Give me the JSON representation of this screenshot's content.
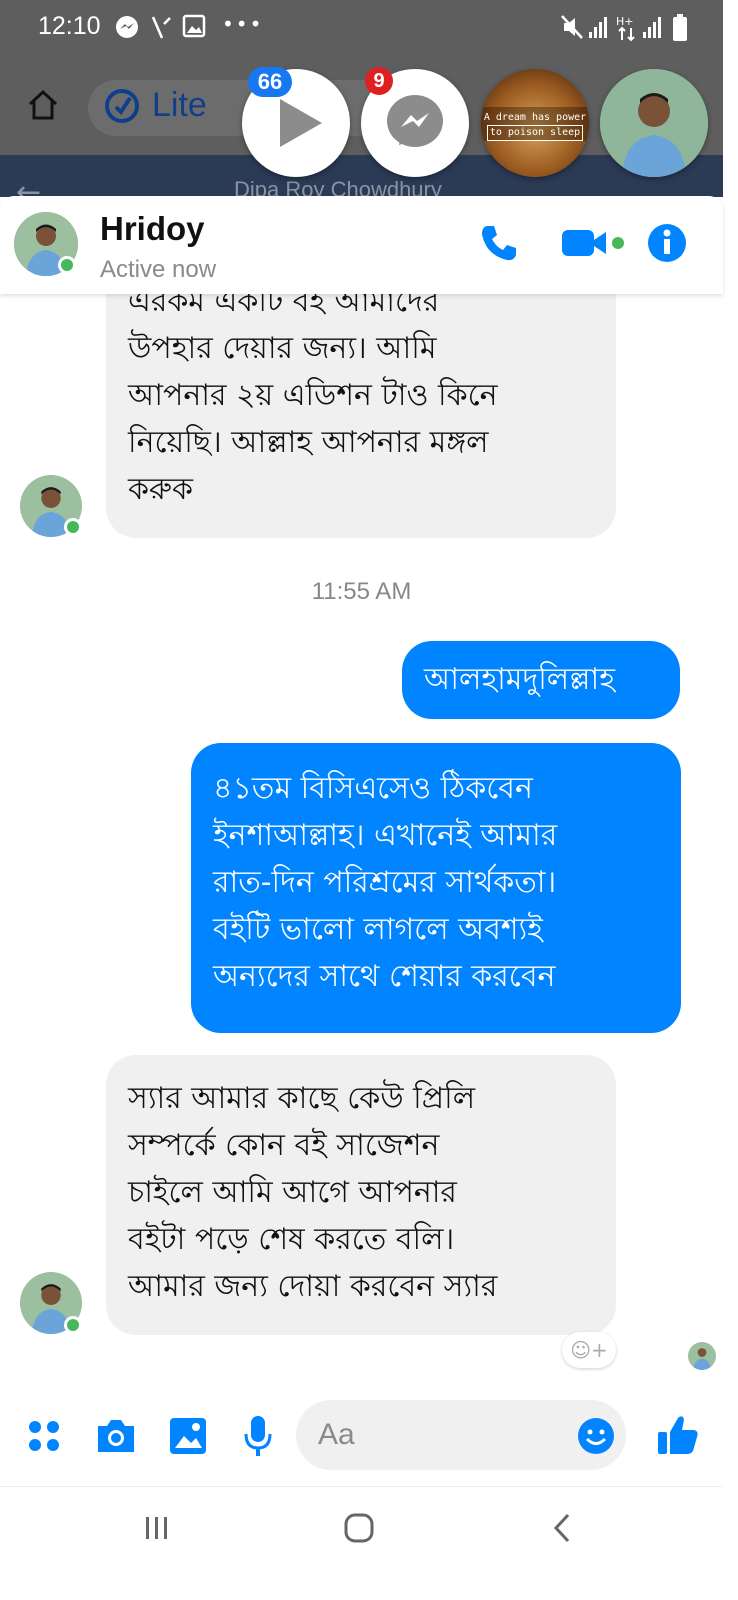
{
  "status_bar": {
    "time": "12:10",
    "icons": [
      "messenger-icon",
      "missed-call-icon",
      "gallery-icon",
      "more-dots-icon",
      "mute-icon",
      "signal-icon",
      "data-icon",
      "signal-icon",
      "battery-icon"
    ],
    "more_text": "•••"
  },
  "browser": {
    "lite_label": "Lite",
    "background_title": "Dipa Roy Chowdhury"
  },
  "chat_heads": [
    {
      "name": "video-player",
      "badge": "66",
      "badge_color": "#1877f2"
    },
    {
      "name": "messenger",
      "badge": "9",
      "badge_color": "#e02020"
    },
    {
      "name": "dream-quote",
      "caption_line1": "A dream has power",
      "caption_line2": "to poison sleep"
    },
    {
      "name": "profile"
    }
  ],
  "header": {
    "name": "Hridoy",
    "status": "Active now"
  },
  "messages": {
    "incoming_1_lines": [
      "এরকম একটি বই আমাদের",
      "উপহার দেয়ার জন্য। আমি",
      "আপনার ২য় এডিশন টাও কিনে",
      "নিয়েছি। আল্লাহ আপনার মঙ্গল",
      "করুক"
    ],
    "timestamp": "11:55 AM",
    "outgoing_1": "আলহামদুলিল্লাহ",
    "outgoing_2_lines": [
      "৪১তম বিসিএসেও ঠিকবেন",
      "ইনশাআল্লাহ।  এখানেই আমার",
      "রাত-দিন পরিশ্রমের সার্থকতা।",
      "বইটি ভালো লাগলে অবশ্যই",
      "অন্যদের সাথে শেয়ার করবেন"
    ],
    "incoming_2_lines": [
      "স্যার আমার কাছে কেউ প্রিলি",
      "সম্পর্কে কোন বই সাজেশন",
      "চাইলে আমি আগে আপনার",
      "বইটা পড়ে শেষ করতে বলি।",
      "আমার জন্য দোয়া করবেন স্যার"
    ],
    "reaction_hint": "☺+"
  },
  "composer": {
    "placeholder": "Aa"
  },
  "colors": {
    "accent": "#0084ff",
    "online": "#44b85a",
    "bubble_in": "#f0f0f0"
  }
}
